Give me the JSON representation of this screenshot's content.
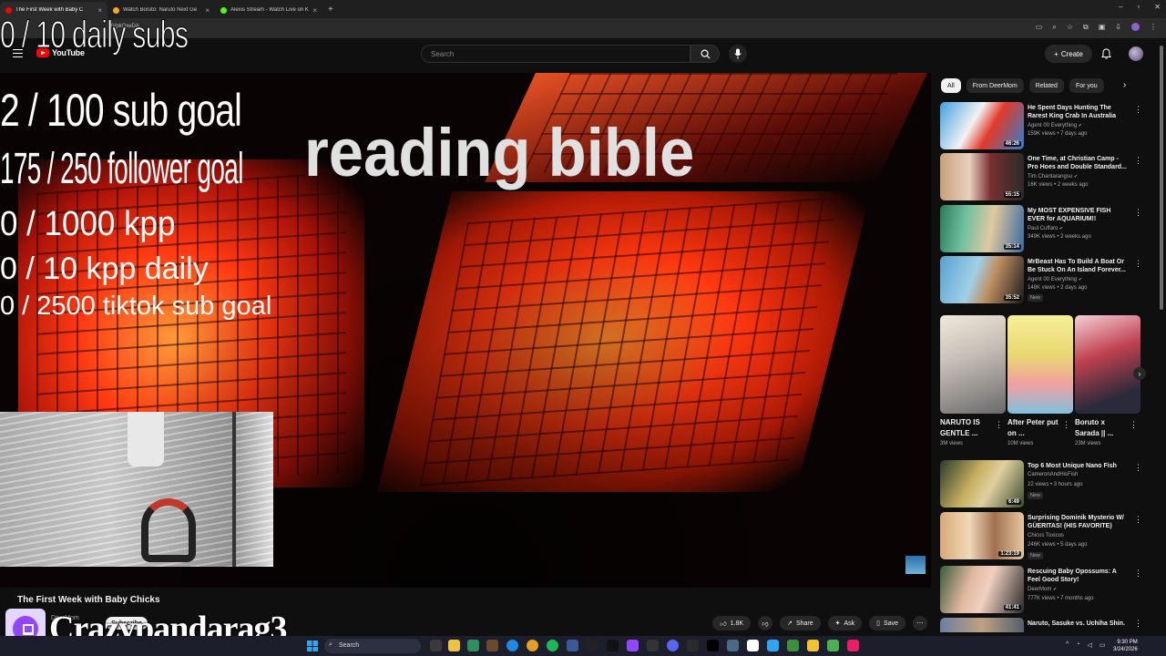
{
  "browser": {
    "tabs": [
      {
        "label": "The First Week with Baby C",
        "active": true,
        "color": "#ff0000"
      },
      {
        "label": "Watch Boruto: Naruto Next Ge",
        "active": false,
        "color": "#f5a623"
      },
      {
        "label": "Alexis Stream - Watch Live on K",
        "active": false,
        "color": "#53fc18"
      }
    ],
    "url_fragment": "9VpkQxeDA"
  },
  "youtube": {
    "logo_text": "YouTube",
    "search_placeholder": "Search",
    "create_label": "Create"
  },
  "overlay": {
    "daily_subs": "0 / 10 daily subs",
    "sub_goal": "2  / 100 sub goal",
    "follower_goal": "175 / 250 follower goal",
    "kpp": "0 / 1000 kpp",
    "kpp_daily": "0 / 10 kpp daily",
    "tiktok_goal": "0 / 2500 tiktok sub goal",
    "video_caption": "reading bible",
    "streamer_name": "Crazypandarag3"
  },
  "video": {
    "title": "The First Week with Baby Chicks",
    "channel": "DeerMom",
    "subscribe_label": "Subscribe",
    "actions": {
      "likes": "1.8K",
      "share": "Share",
      "ask": "Ask",
      "save": "Save"
    }
  },
  "sidebar": {
    "chips": [
      "All",
      "From DeerMom",
      "Related",
      "For you"
    ],
    "recs_top": [
      {
        "title": "He Spent Days Hunting The Rarest King Crab In Australia",
        "channel": "Agent 00 Everything",
        "meta": "159K views • 7 days ago",
        "duration": "46:26",
        "new": false
      },
      {
        "title": "One Time, at Christian Camp - Pro Hoes and Double Standard...",
        "channel": "Tim Chantarangsu",
        "meta": "16K views • 2 weeks ago",
        "duration": "55:15",
        "new": false
      },
      {
        "title": "My MOST EXPENSIVE FISH EVER for AQUARIUM!!",
        "channel": "Paul Cuffaro",
        "meta": "349K views • 2 weeks ago",
        "duration": "35:14",
        "new": false
      },
      {
        "title": "MrBeast Has To Build A Boat Or Be Stuck On An Island Forever...",
        "channel": "Agent 00 Everything",
        "meta": "148K views • 2 days ago",
        "duration": "35:52",
        "new": true
      }
    ],
    "shorts": [
      {
        "title": "NARUTO IS GENTLE ...",
        "views": "3M views"
      },
      {
        "title": "After Peter put on ...",
        "views": "10M views"
      },
      {
        "title": "Boruto x Sarada || ...",
        "views": "23M views"
      }
    ],
    "recs_bottom": [
      {
        "title": "Top 6 Most Unique Nano Fish",
        "channel": "CameronAndHisFish",
        "meta": "22 views • 3 hours ago",
        "duration": "6:49",
        "new": true
      },
      {
        "title": "Surprising Dominik Mysterio W/ GÜERITAS! (HIS FAVORITE)",
        "channel": "Chicos Toxicos",
        "meta": "246K views • 5 days ago",
        "duration": "1:23:19",
        "new": true
      },
      {
        "title": "Rescuing Baby Opossums: A Feel Good Story!",
        "channel": "DeerMom",
        "meta": "777K views • 7 months ago",
        "duration": "41:41",
        "new": false
      },
      {
        "title": "Naruto, Sasuke vs. Uchiha Shin.",
        "channel": "",
        "meta": "",
        "duration": "",
        "new": false
      }
    ],
    "new_label": "New"
  },
  "taskbar": {
    "search_label": "Search",
    "time": "9:30 PM",
    "date": "3/24/2026"
  },
  "colors": {
    "accent_red": "#ff0000",
    "twitch_purple": "#9146ff",
    "video_red": "#ff3b10"
  }
}
